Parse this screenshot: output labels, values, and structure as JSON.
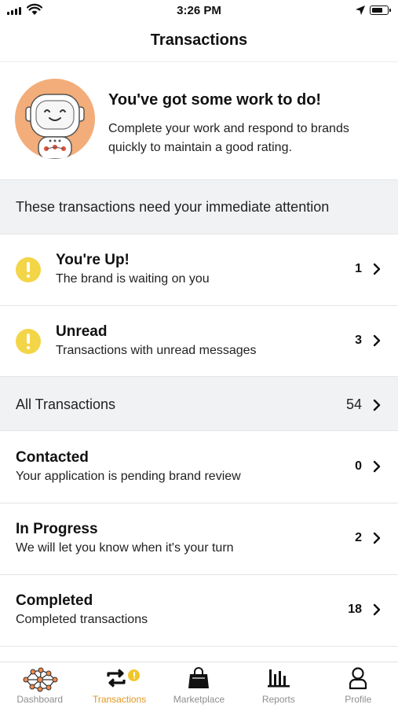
{
  "status_bar": {
    "time": "3:26 PM"
  },
  "nav": {
    "title": "Transactions"
  },
  "hero": {
    "title": "You've got some work to do!",
    "text": "Complete your work and respond to brands quickly to maintain a good rating."
  },
  "attention": {
    "header": "These transactions need your immediate attention",
    "rows": [
      {
        "title": "You're Up!",
        "subtitle": "The brand is waiting on you",
        "count": "1"
      },
      {
        "title": "Unread",
        "subtitle": "Transactions with unread messages",
        "count": "3"
      }
    ]
  },
  "all": {
    "header": "All Transactions",
    "count": "54",
    "rows": [
      {
        "title": "Contacted",
        "subtitle": "Your application is pending brand review",
        "count": "0"
      },
      {
        "title": "In Progress",
        "subtitle": "We will let you know when it's your turn",
        "count": "2"
      },
      {
        "title": "Completed",
        "subtitle": "Completed transactions",
        "count": "18"
      }
    ]
  },
  "tabs": [
    {
      "label": "Dashboard",
      "icon": "network-icon",
      "active": false
    },
    {
      "label": "Transactions",
      "icon": "transfer-icon",
      "active": true
    },
    {
      "label": "Marketplace",
      "icon": "shopping-bag-icon",
      "active": false
    },
    {
      "label": "Reports",
      "icon": "bar-chart-icon",
      "active": false
    },
    {
      "label": "Profile",
      "icon": "person-icon",
      "active": false
    }
  ],
  "colors": {
    "warning": "#f3d548",
    "active_tab": "#e2961e",
    "avatar_bg": "#f3ad7a",
    "section_bg": "#f1f2f4"
  }
}
